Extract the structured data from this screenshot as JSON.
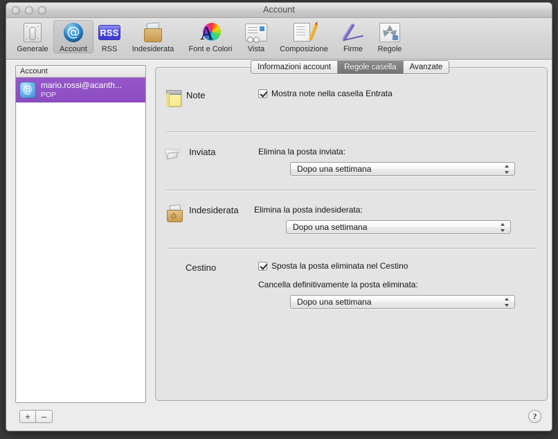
{
  "window": {
    "title": "Account",
    "traffic_lights": [
      "close",
      "minimize",
      "zoom"
    ]
  },
  "toolbar": {
    "items": [
      {
        "label": "Generale",
        "icon": "switch-icon",
        "selected": false
      },
      {
        "label": "Account",
        "icon": "at-sign-icon",
        "selected": true
      },
      {
        "label": "RSS",
        "icon": "rss-icon",
        "selected": false
      },
      {
        "label": "Indesiderata",
        "icon": "junk-bin-icon",
        "selected": false
      },
      {
        "label": "Font e Colori",
        "icon": "font-color-wheel-icon",
        "selected": false
      },
      {
        "label": "Vista",
        "icon": "view-glasses-icon",
        "selected": false
      },
      {
        "label": "Composizione",
        "icon": "compose-pencil-icon",
        "selected": false
      },
      {
        "label": "Firme",
        "icon": "signature-pen-icon",
        "selected": false
      },
      {
        "label": "Regole",
        "icon": "rules-arrows-icon",
        "selected": false
      }
    ]
  },
  "sidebar": {
    "header": "Account",
    "accounts": [
      {
        "name": "mario.rossi@acanth...",
        "type": "POP",
        "selected": true,
        "icon": "at-sign-icon"
      }
    ],
    "add_button": "+",
    "remove_button": "–"
  },
  "tabs": [
    {
      "label": "Informazioni account",
      "active": false
    },
    {
      "label": "Regole casella",
      "active": true
    },
    {
      "label": "Avanzate",
      "active": false
    }
  ],
  "content": {
    "note": {
      "section_label": "Note",
      "icon": "notepad-icon",
      "checkbox_label": "Mostra note nella casella Entrata",
      "checkbox_checked": true
    },
    "sent": {
      "section_label": "Inviata",
      "icon": "paper-plane-icon",
      "field_label": "Elimina la posta inviata:",
      "popup_value": "Dopo una settimana"
    },
    "junk": {
      "section_label": "Indesiderata",
      "icon": "junk-bin-icon",
      "field_label": "Elimina la posta indesiderata:",
      "popup_value": "Dopo una settimana"
    },
    "trash": {
      "section_label": "Cestino",
      "checkbox_label": "Sposta la posta eliminata nel Cestino",
      "checkbox_checked": true,
      "field_label": "Cancella definitivamente la posta eliminata:",
      "popup_value": "Dopo una settimana"
    }
  },
  "help": {
    "label": "?"
  },
  "colors": {
    "selection_purple": "#8a4cc0",
    "active_tab_gray": "#7e7e7e",
    "window_bg": "#ececec",
    "pane_bg": "#e4e4e4"
  }
}
